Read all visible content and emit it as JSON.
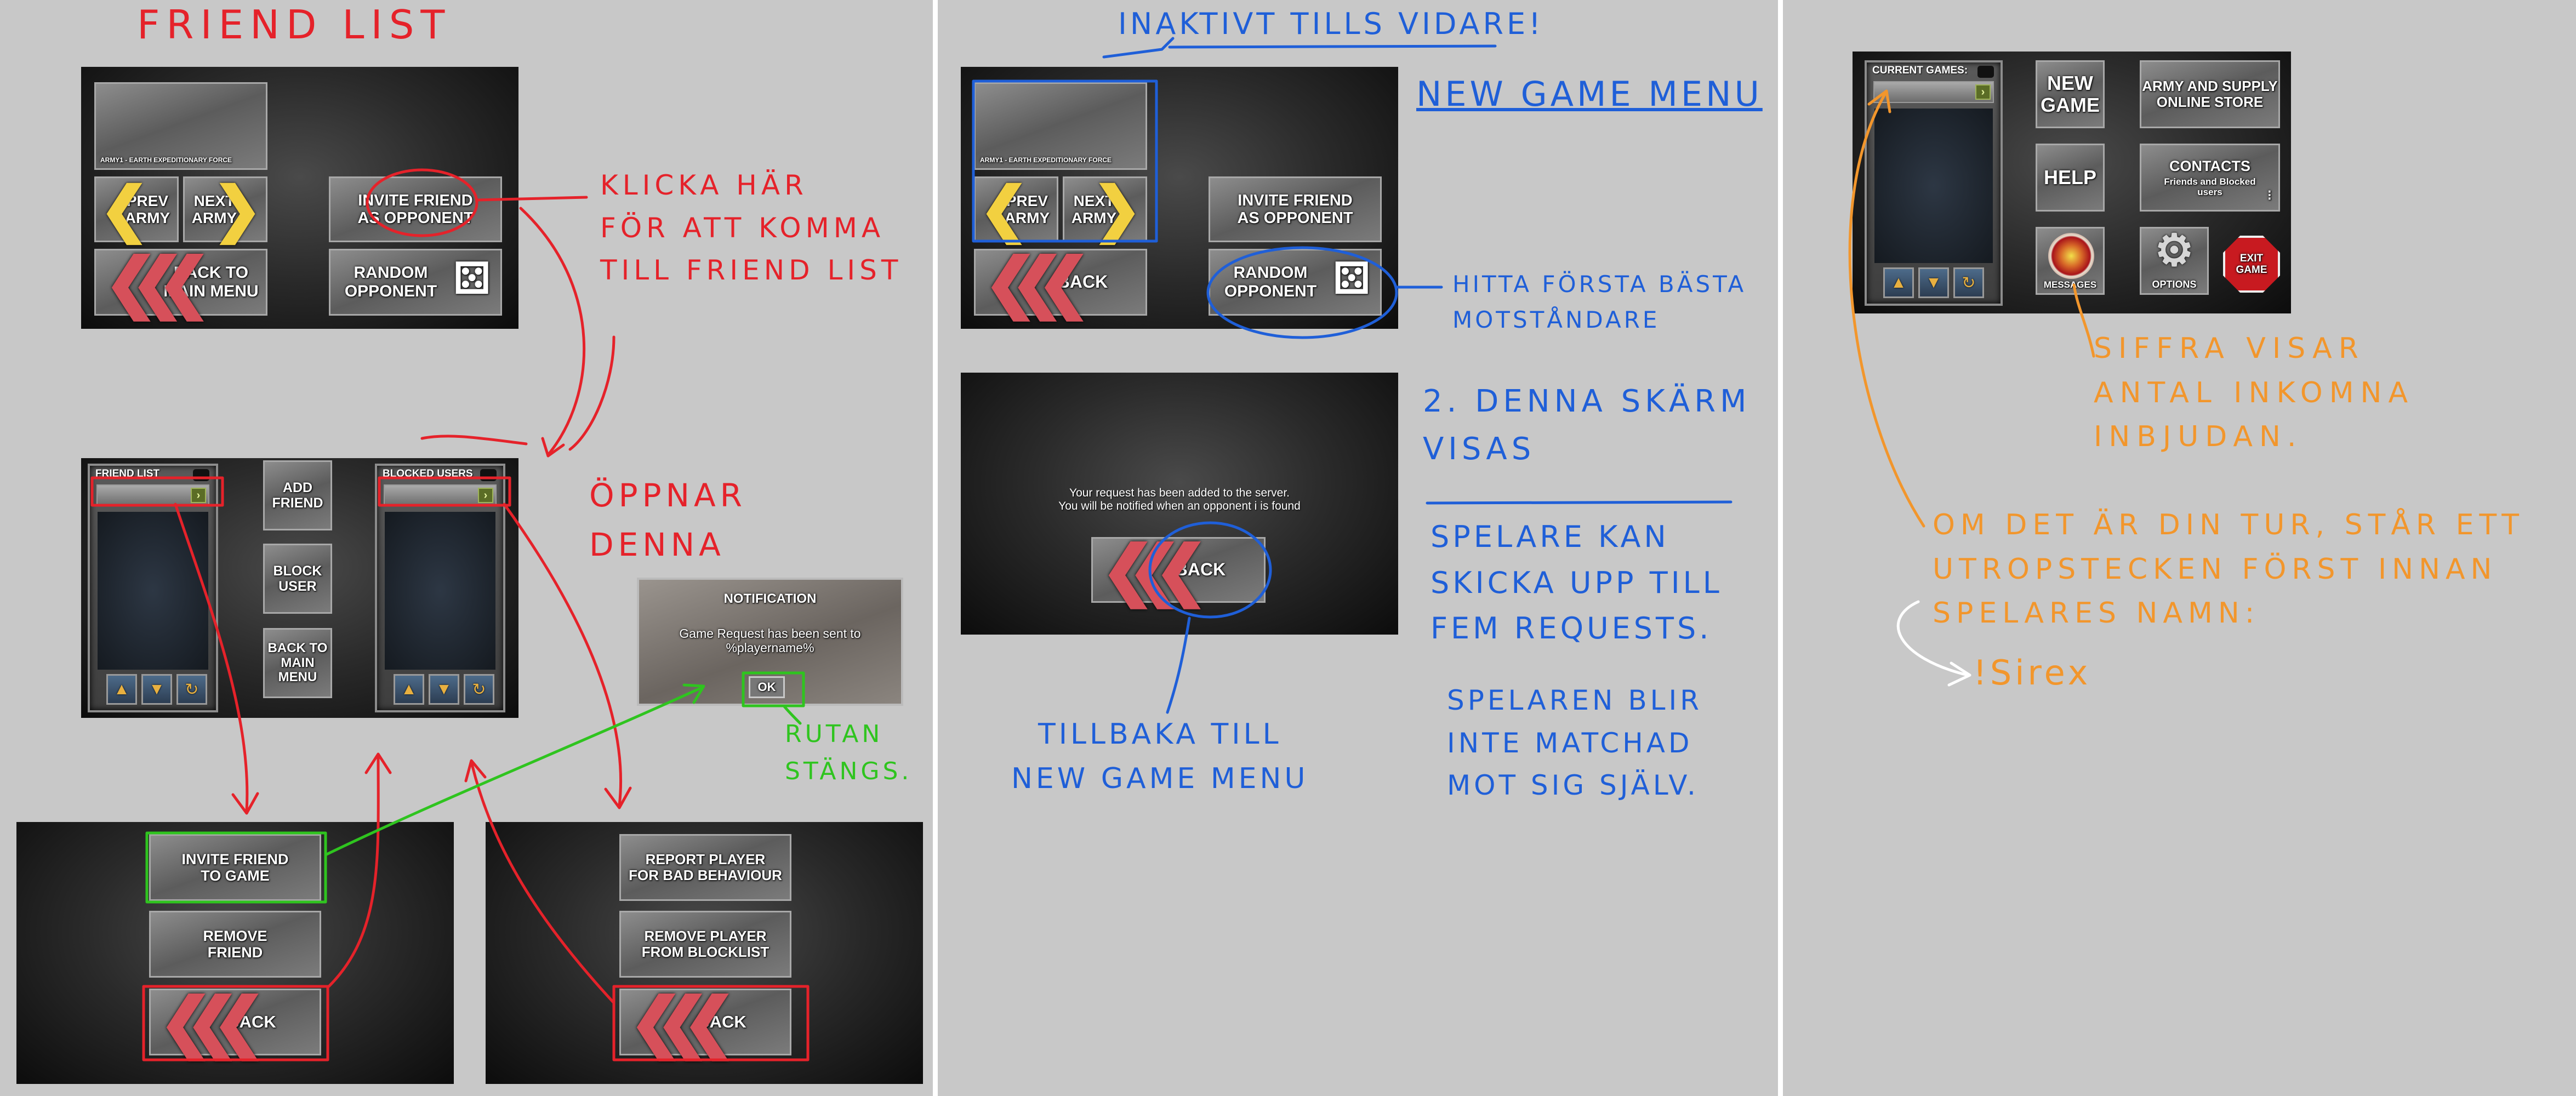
{
  "colors": {
    "bg": "#c8c8c8",
    "red": "#e5222a",
    "blue": "#1f5fd8",
    "green": "#2fc41f",
    "orange": "#f2962c",
    "white": "#ffffff"
  },
  "p1": {
    "title": "FRIEND LIST",
    "army_label": "ARMY1 - EARTH EXPEDITIONARY FORCE",
    "prev_army": "PREV\nARMY",
    "next_army": "NEXT\nARMY",
    "invite_friend": "INVITE FRIEND\nAS OPPONENT",
    "back_main": "BACK TO\nMAIN MENU",
    "random_opponent": "RANDOM\nOPPONENT",
    "note_click": "KLICKA HÄR\nFÖR ATT KOMMA\nTILL FRIEND LIST",
    "friend_list_label": "FRIEND LIST",
    "blocked_users_label": "BLOCKED USERS",
    "add_friend": "ADD\nFRIEND",
    "block_user": "BLOCK\nUSER",
    "back_to_main_menu": "BACK TO\nMAIN\nMENU",
    "note_opens": "ÖPPNAR\nDENNA",
    "notification_title": "NOTIFICATION",
    "notification_body": "Game Request has been sent to\n%playername%",
    "ok": "OK",
    "note_closes": "RUTAN\nSTÄNGS.",
    "invite_to_game": "INVITE FRIEND\nTO GAME",
    "remove_friend": "REMOVE\nFRIEND",
    "back": "BACK",
    "report_player": "REPORT PLAYER\nFOR BAD BEHAVIOUR",
    "remove_blocklist": "REMOVE PLAYER\nFROM BLOCKLIST",
    "back2": "BACK"
  },
  "p2": {
    "note_inactive": "INAKTIVT TILLS VIDARE!",
    "heading": "NEW GAME MENU",
    "army_label": "ARMY1 - EARTH EXPEDITIONARY FORCE",
    "prev_army": "PREV\nARMY",
    "next_army": "NEXT\nARMY",
    "invite_friend": "INVITE FRIEND\nAS OPPONENT",
    "back": "BACK",
    "random_opponent": "RANDOM\nOPPONENT",
    "note_best": "HITTA FÖRSTA BÄSTA\nMOTSTÅNDARE",
    "request_msg": "Your request has been added to the server.\nYou will be notified when an opponent i is found",
    "back2": "BACK",
    "note_screen": "2. DENNA SKÄRM\nVISAS",
    "note_back": "TILLBAKA TILL\nNEW GAME MENU",
    "note_requests": "SPELARE KAN\nSKICKA UPP TILL\nFEM REQUESTS.",
    "note_match": "SPELAREN BLIR\nINTE MATCHAD\nMOT SIG SJÄLV."
  },
  "p3": {
    "current_games": "CURRENT GAMES:",
    "new_game": "NEW\nGAME",
    "store": "ARMY AND SUPPLY\nONLINE STORE",
    "help": "HELP",
    "contacts": "CONTACTS",
    "contacts_sub": "Friends and Blocked\nusers",
    "messages": "MESSAGES",
    "options": "OPTIONS",
    "exit": "EXIT\nGAME",
    "note_count": "SIFFRA VISAR\nANTAL INKOMNA\nINBJUDAN.",
    "note_turn": "OM DET ÄR DIN TUR, STÅR ETT\nUTROPSTECKEN FÖRST INNAN\nSPELARES NAMN:",
    "example_name": "!Sirex"
  },
  "icons": [
    "chevron-left-icon",
    "chevron-right-icon",
    "triple-chevron-back-icon",
    "dice-icon",
    "arrow-up-icon",
    "arrow-down-icon",
    "refresh-icon",
    "messages-icon",
    "gear-icon",
    "stop-sign-icon"
  ]
}
